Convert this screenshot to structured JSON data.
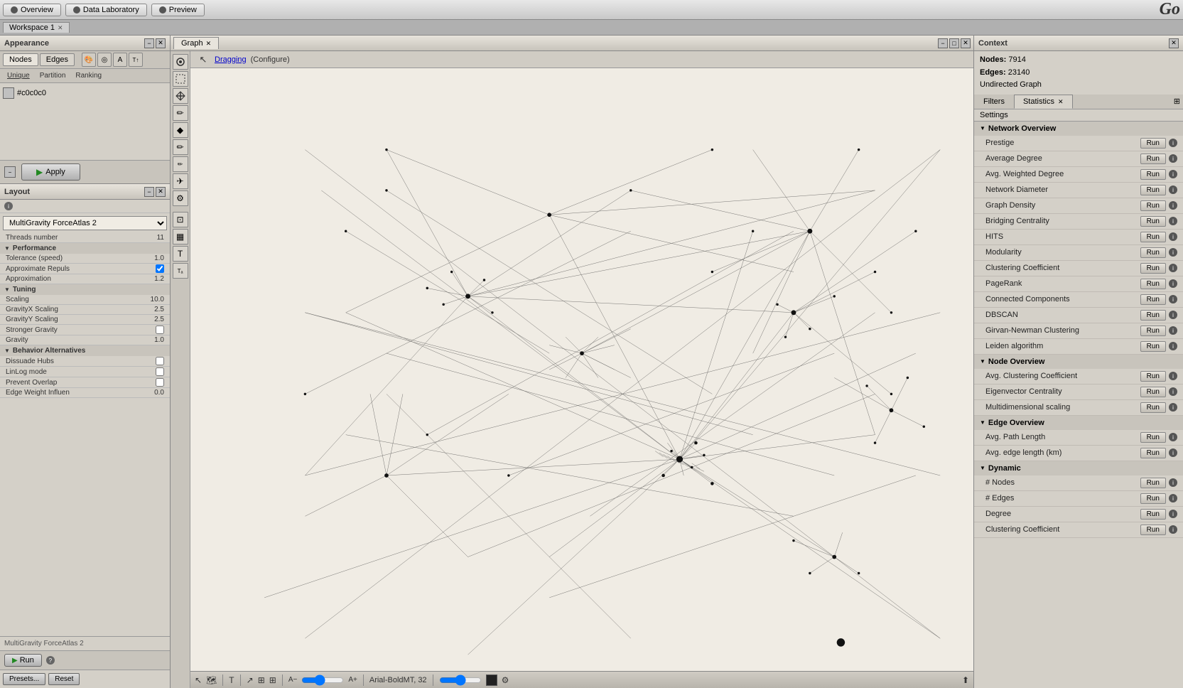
{
  "topBar": {
    "buttons": [
      {
        "label": "Overview",
        "id": "overview"
      },
      {
        "label": "Data Laboratory",
        "id": "data-lab"
      },
      {
        "label": "Preview",
        "id": "preview"
      }
    ],
    "logo": "Go"
  },
  "workspaceBar": {
    "tab": "Workspace 1"
  },
  "leftPanel": {
    "title": "Appearance",
    "nodes_label": "Nodes",
    "edges_label": "Edges",
    "icons": [
      "🎨",
      "↻",
      "A",
      "T"
    ],
    "subTabs": [
      "Unique",
      "Partition",
      "Ranking"
    ],
    "activeSubTab": "Unique",
    "colorValue": "#c0c0c0",
    "apply_label": "Apply",
    "layoutTitle": "Layout",
    "layoutSelect": "MultiGravity ForceAtlas 2",
    "run_label": "Run",
    "helpChar": "?",
    "params": [
      {
        "section": "Performance",
        "items": [
          {
            "label": "Tolerance (speed)",
            "value": "1.0",
            "type": "number"
          },
          {
            "label": "Approximate Repuls",
            "value": "checked",
            "type": "checkbox"
          },
          {
            "label": "Approximation",
            "value": "1.2",
            "type": "number"
          }
        ]
      },
      {
        "section": "Tuning",
        "items": [
          {
            "label": "Scaling",
            "value": "10.0",
            "type": "number"
          },
          {
            "label": "GravityX Scaling",
            "value": "2.5",
            "type": "number"
          },
          {
            "label": "GravityY Scaling",
            "value": "2.5",
            "type": "number"
          },
          {
            "label": "Stronger Gravity",
            "value": "",
            "type": "checkbox"
          },
          {
            "label": "Gravity",
            "value": "1.0",
            "type": "number"
          }
        ]
      },
      {
        "section": "Behavior Alternatives",
        "items": [
          {
            "label": "Dissuade Hubs",
            "value": "",
            "type": "checkbox"
          },
          {
            "label": "LinLog mode",
            "value": "",
            "type": "checkbox"
          },
          {
            "label": "Prevent Overlap",
            "value": "",
            "type": "checkbox"
          },
          {
            "label": "Edge Weight Influen",
            "value": "0.0",
            "type": "number"
          }
        ]
      }
    ],
    "infoLabel": "MultiGravity ForceAtlas 2",
    "presetsLabel": "Presets...",
    "resetLabel": "Reset",
    "threads_label": "Threads number",
    "threads_value": "11"
  },
  "graphPanel": {
    "title": "Graph",
    "draggingLabel": "Dragging",
    "configureLabel": "(Configure)"
  },
  "rightPanel": {
    "title": "Context",
    "nodesLabel": "Nodes:",
    "nodesValue": "7914",
    "edgesLabel": "Edges:",
    "edgesValue": "23140",
    "graphTypeLabel": "Undirected Graph",
    "filtersTab": "Filters",
    "statisticsTab": "Statistics",
    "settingsTab": "Settings",
    "sections": [
      {
        "title": "Network Overview",
        "items": [
          {
            "label": "Prestige"
          },
          {
            "label": "Average Degree"
          },
          {
            "label": "Avg. Weighted Degree"
          },
          {
            "label": "Network Diameter"
          },
          {
            "label": "Graph Density"
          },
          {
            "label": "Bridging Centrality"
          },
          {
            "label": "HITS"
          },
          {
            "label": "Modularity"
          },
          {
            "label": "Clustering Coefficient"
          },
          {
            "label": "PageRank"
          },
          {
            "label": "Connected Components"
          },
          {
            "label": "DBSCAN"
          },
          {
            "label": "Girvan-Newman Clustering"
          },
          {
            "label": "Leiden algorithm"
          }
        ]
      },
      {
        "title": "Node Overview",
        "items": [
          {
            "label": "Avg. Clustering Coefficient"
          },
          {
            "label": "Eigenvector Centrality"
          },
          {
            "label": "Multidimensional scaling"
          }
        ]
      },
      {
        "title": "Edge Overview",
        "items": [
          {
            "label": "Avg. Path Length"
          },
          {
            "label": "Avg. edge length (km)"
          }
        ]
      },
      {
        "title": "Dynamic",
        "items": [
          {
            "label": "# Nodes"
          },
          {
            "label": "# Edges"
          },
          {
            "label": "Degree"
          },
          {
            "label": "Clustering Coefficient"
          }
        ]
      }
    ],
    "runLabel": "Run"
  },
  "bottomToolbar": {
    "fontName": "Arial-BoldMT, 32"
  }
}
